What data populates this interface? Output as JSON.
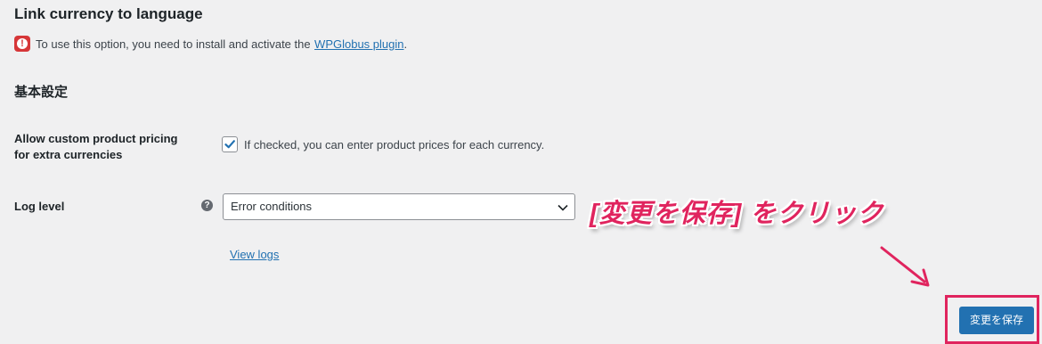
{
  "section": {
    "title": "Link currency to language"
  },
  "notice": {
    "icon": "warning-icon",
    "text": "To use this option, you need to install and activate the",
    "link_text": "WPGlobus plugin",
    "end": "."
  },
  "basic_settings": {
    "title": "基本設定"
  },
  "custom_pricing": {
    "label_line1": "Allow custom product pricing",
    "label_line2": "for extra currencies",
    "checked": true,
    "description": "If checked, you can enter product prices for each currency."
  },
  "log_level": {
    "label": "Log level",
    "help_icon": "help-icon",
    "selected": "Error conditions",
    "view_logs": "View logs"
  },
  "annotation": {
    "text": "[変更を保存] をクリック",
    "color": "#e0245e"
  },
  "save_button": {
    "label": "変更を保存",
    "color": "#2271b1"
  }
}
